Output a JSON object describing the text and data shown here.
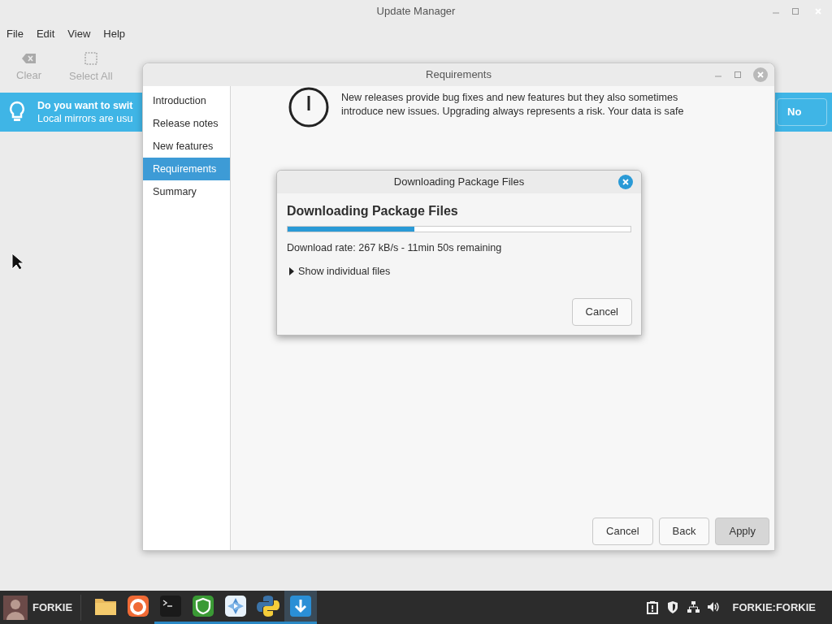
{
  "main_window": {
    "title": "Update Manager",
    "menu": [
      "File",
      "Edit",
      "View",
      "Help"
    ],
    "toolbar": [
      {
        "kind": "clear",
        "label": "Clear",
        "disabled": true
      },
      {
        "kind": "select",
        "label": "Select All",
        "disabled": true
      }
    ],
    "infobar": {
      "title": "Do you want to swit",
      "text": "Local mirrors are usu",
      "button": "No"
    }
  },
  "requirements_window": {
    "title": "Requirements",
    "sidebar": [
      {
        "label": "Introduction",
        "selected": false
      },
      {
        "label": "Release notes",
        "selected": false
      },
      {
        "label": "New features",
        "selected": false
      },
      {
        "label": "Requirements",
        "selected": true
      },
      {
        "label": "Summary",
        "selected": false
      }
    ],
    "message": [
      "New releases provide bug fixes and new features but they also sometimes",
      "introduce new issues. Upgrading always represents a risk. Your data is safe"
    ],
    "buttons": [
      {
        "label": "Cancel",
        "default": false
      },
      {
        "label": "Back",
        "default": false
      },
      {
        "label": "Apply",
        "default": true
      }
    ]
  },
  "download_dialog": {
    "title": "Downloading Package Files",
    "heading": "Downloading Package Files",
    "level": 0.37,
    "status": "Download rate: 267 kB/s - 11min 50s remaining",
    "expander": {
      "label": "Show individual files",
      "expanded": false
    },
    "button": "Cancel"
  },
  "taskbar": {
    "user": "FORKIE",
    "apps": [
      {
        "kind": "folder",
        "running": false,
        "selected": false
      },
      {
        "kind": "browser",
        "running": false,
        "selected": false
      },
      {
        "kind": "terminal",
        "running": true,
        "selected": false
      },
      {
        "kind": "shield",
        "running": true,
        "selected": false
      },
      {
        "kind": "pinwheel",
        "running": true,
        "selected": false
      },
      {
        "kind": "python",
        "running": true,
        "selected": false
      },
      {
        "kind": "download",
        "running": true,
        "selected": true
      }
    ],
    "tray": [
      {
        "kind": "clipboard"
      },
      {
        "kind": "shield"
      },
      {
        "kind": "network"
      },
      {
        "kind": "volume"
      }
    ],
    "session": "FORKIE:FORKIE"
  }
}
